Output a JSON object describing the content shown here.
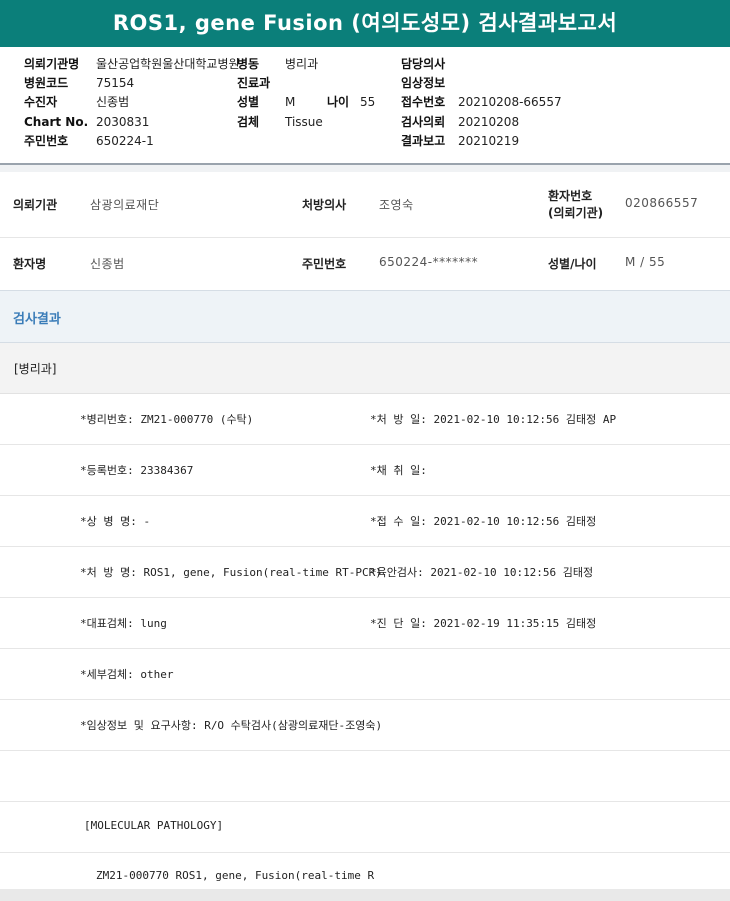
{
  "title": "ROS1, gene Fusion (여의도성모) 검사결과보고서",
  "top_info": {
    "hospital_label": "의뢰기관명",
    "hospital_value": "울산공업학원울산대학교병원",
    "ward_label": "병동",
    "ward_value": "병리과",
    "doctor_label": "담당의사",
    "doctor_value": "",
    "code_label": "병원코드",
    "code_value": "75154",
    "dept_label": "진료과",
    "dept_value": "",
    "clinical_label": "임상정보",
    "clinical_value": "",
    "recipient_label": "수진자",
    "recipient_value": "신종범",
    "sex_label": "성별",
    "sex_value": "M",
    "age_label": "나이",
    "age_value": "55",
    "receipt_label": "접수번호",
    "receipt_value": "20210208-66557",
    "chart_label": "Chart No.",
    "chart_value": "2030831",
    "specimen_label": "검체",
    "specimen_value": "Tissue",
    "request_label": "검사의뢰",
    "request_value": "20210208",
    "rrn_label": "주민번호",
    "rrn_value": "650224-1",
    "report_label": "결과보고",
    "report_value": "20210219"
  },
  "patient": {
    "org_label": "의뢰기관",
    "org_value": "삼광의료재단",
    "prescriber_label": "처방의사",
    "prescriber_value": "조영숙",
    "patient_no_label_1": "환자번호",
    "patient_no_label_2": "(의뢰기관)",
    "patient_no_value": "020866557",
    "name_label": "환자명",
    "name_value": "신종범",
    "rrn_label": "주민번호",
    "rrn_value": "650224-*******",
    "sex_age_label": "성별/나이",
    "sex_age_value": "M / 55"
  },
  "results": {
    "header": "검사결과",
    "department": "[병리과]",
    "rows": [
      {
        "left": "*병리번호: ZM21-000770 (수탁)",
        "right": "*처 방 일: 2021-02-10 10:12:56  김태정 AP"
      },
      {
        "left": "*등록번호: 23384367",
        "right": "*채 취 일:"
      },
      {
        "left": "*상 병 명: -",
        "right": "*접 수 일: 2021-02-10 10:12:56  김태정"
      },
      {
        "left": "*처 방 명: ROS1, gene, Fusion(real-time RT-PCR)",
        "right": "*육안검사: 2021-02-10 10:12:56  김태정"
      },
      {
        "left": "*대표검체: lung",
        "right": "*진 단 일: 2021-02-19 11:35:15  김태정"
      },
      {
        "left": "*세부검체: other",
        "right": ""
      },
      {
        "left": "*임상정보 및 요구사항: R/O 수탁검사(삼광의료재단-조영숙)",
        "right": ""
      },
      {
        "left": "",
        "right": ""
      }
    ],
    "molecular_header": "[MOLECULAR PATHOLOGY]",
    "molecular_line": "ZM21-000770     ROS1, gene, Fusion(real-time R"
  }
}
